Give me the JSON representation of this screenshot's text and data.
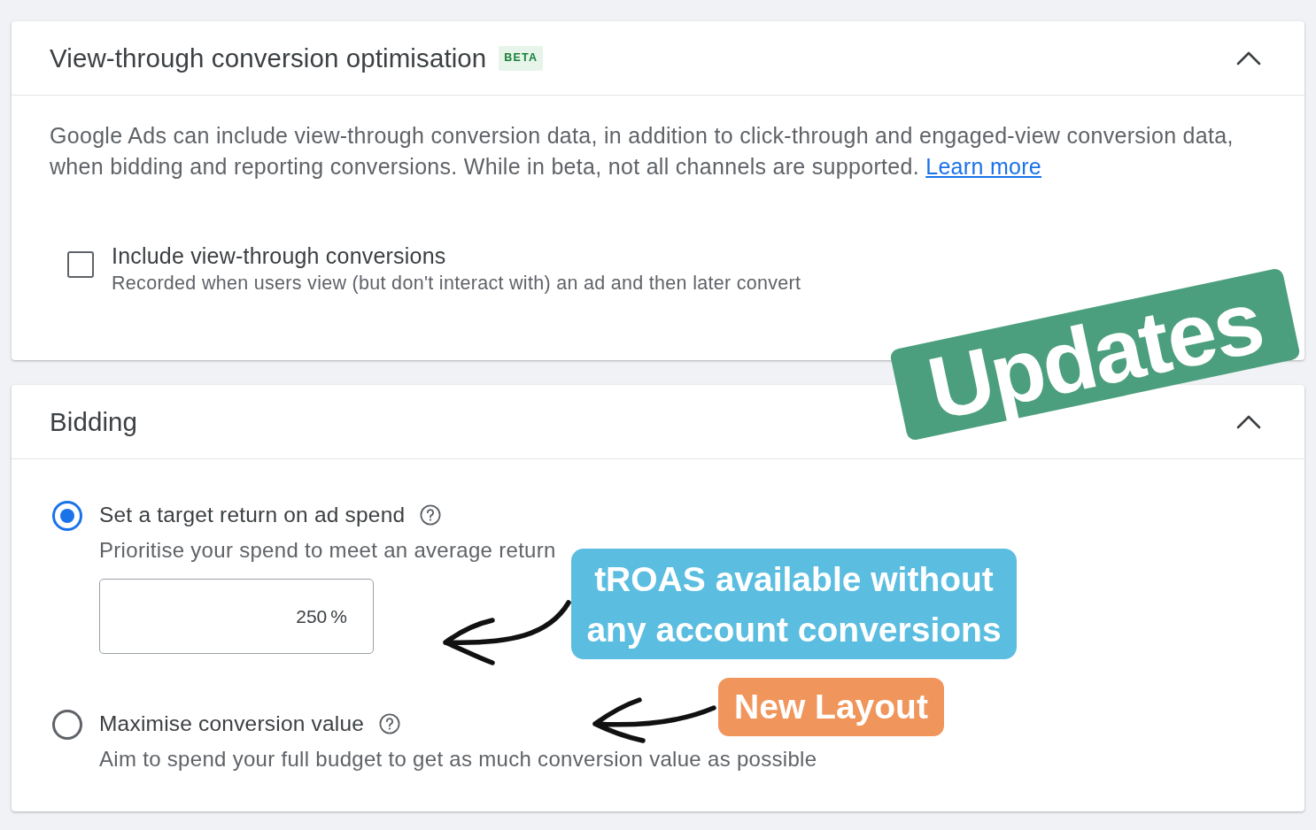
{
  "view_through_panel": {
    "title": "View-through conversion optimisation",
    "badge": "BETA",
    "expanded": true,
    "description": "Google Ads can include view-through conversion data, in addition to click-through and engaged-view conversion data, when bidding and reporting conversions. While in beta, not all channels are supported.",
    "link": "Learn more",
    "option": {
      "label": "Include view-through conversions",
      "hint": "Recorded when users view (but don't interact with) an ad and then later convert",
      "checked": false
    }
  },
  "bidding_panel": {
    "title": "Bidding",
    "expanded": true,
    "options": [
      {
        "label": "Set a target return on ad spend",
        "hint": "Prioritise your spend to meet an average return",
        "selected": true,
        "target": {
          "value": "250",
          "suffix": "%"
        }
      },
      {
        "label": "Maximise conversion value",
        "hint": "Aim to spend your full budget to get as much conversion value as possible",
        "selected": false
      }
    ]
  },
  "annotations": {
    "stamp": "Updates",
    "callouts": [
      {
        "text": "tROAS available without any account conversions",
        "color": "#5bbde0"
      },
      {
        "text": "New Layout",
        "color": "#f0955b"
      }
    ]
  }
}
